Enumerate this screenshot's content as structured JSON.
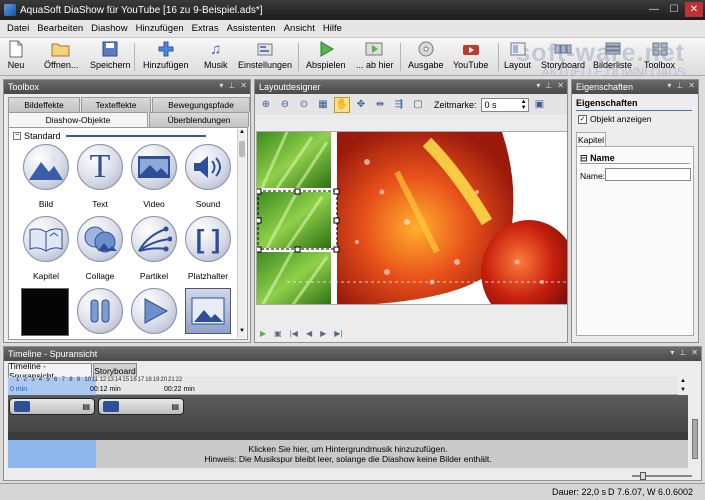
{
  "window": {
    "title": "AquaSoft DiaShow für YouTube [16 zu 9-Beispiel.ads*]"
  },
  "menu": [
    "Datei",
    "Bearbeiten",
    "Diashow",
    "Hinzufügen",
    "Extras",
    "Assistenten",
    "Ansicht",
    "Hilfe"
  ],
  "toolbar": {
    "new": "Neu",
    "open": "Öffnen...",
    "save": "Speichern",
    "add": "Hinzufügen",
    "music": "Musik",
    "settings": "Einstellungen",
    "play": "Abspielen",
    "play_from_here": "... ab hier",
    "output": "Ausgabe",
    "youtube": "YouTube",
    "layout": "Layout",
    "storyboard": "Storyboard",
    "image_list": "Bilderliste",
    "toolbox": "Toolbox"
  },
  "watermark": {
    "brand": "soft-ware.net",
    "tagline": "AKTUELLE DOWNLOADS"
  },
  "toolbox": {
    "title": "Toolbox",
    "tabs_row1": [
      "Bildeffekte",
      "Texteffekte",
      "Bewegungspfade"
    ],
    "tabs_row2": [
      "Diashow-Objekte",
      "Überblendungen"
    ],
    "group": "Standard",
    "objects": [
      "Bild",
      "Text",
      "Video",
      "Sound",
      "Kapitel",
      "Collage",
      "Partikel",
      "Platzhalter"
    ]
  },
  "layoutdesigner": {
    "title": "Layoutdesigner",
    "zeitmarke_label": "Zeitmarke:",
    "zeitmarke_value": "0 s"
  },
  "properties": {
    "title": "Eigenschaften",
    "heading": "Eigenschaften",
    "checkbox_label": "Objekt anzeigen",
    "tab": "Kapitel",
    "section": "Name",
    "name_label": "Name:"
  },
  "timeline": {
    "title": "Timeline - Spuransicht",
    "tabs": [
      "Timeline - Spuransicht",
      "Storyboard"
    ],
    "ruler_ticks": [
      "1",
      "2",
      "3",
      "4",
      "5",
      "6",
      "7",
      "8",
      "9",
      "10",
      "11",
      "12",
      "13",
      "14",
      "15",
      "16",
      "17",
      "18",
      "19",
      "20",
      "21",
      "22"
    ],
    "ruler_labels": [
      "0 min",
      "00:12 min",
      "00:22 min"
    ],
    "music_hint": "Klicken Sie hier, um Hintergrundmusik hinzuzufügen.",
    "music_hint2": "Hinweis: Die Musikspur bleibt leer, solange die Diashow keine Bilder enthält."
  },
  "statusbar": {
    "duration": "Dauer: 22,0 s",
    "version": "D 7.6.07, W 6.0.6002"
  },
  "colors": {
    "accent": "#3757a0",
    "panel_header": "#555555",
    "music_selection": "#8db6ec"
  }
}
